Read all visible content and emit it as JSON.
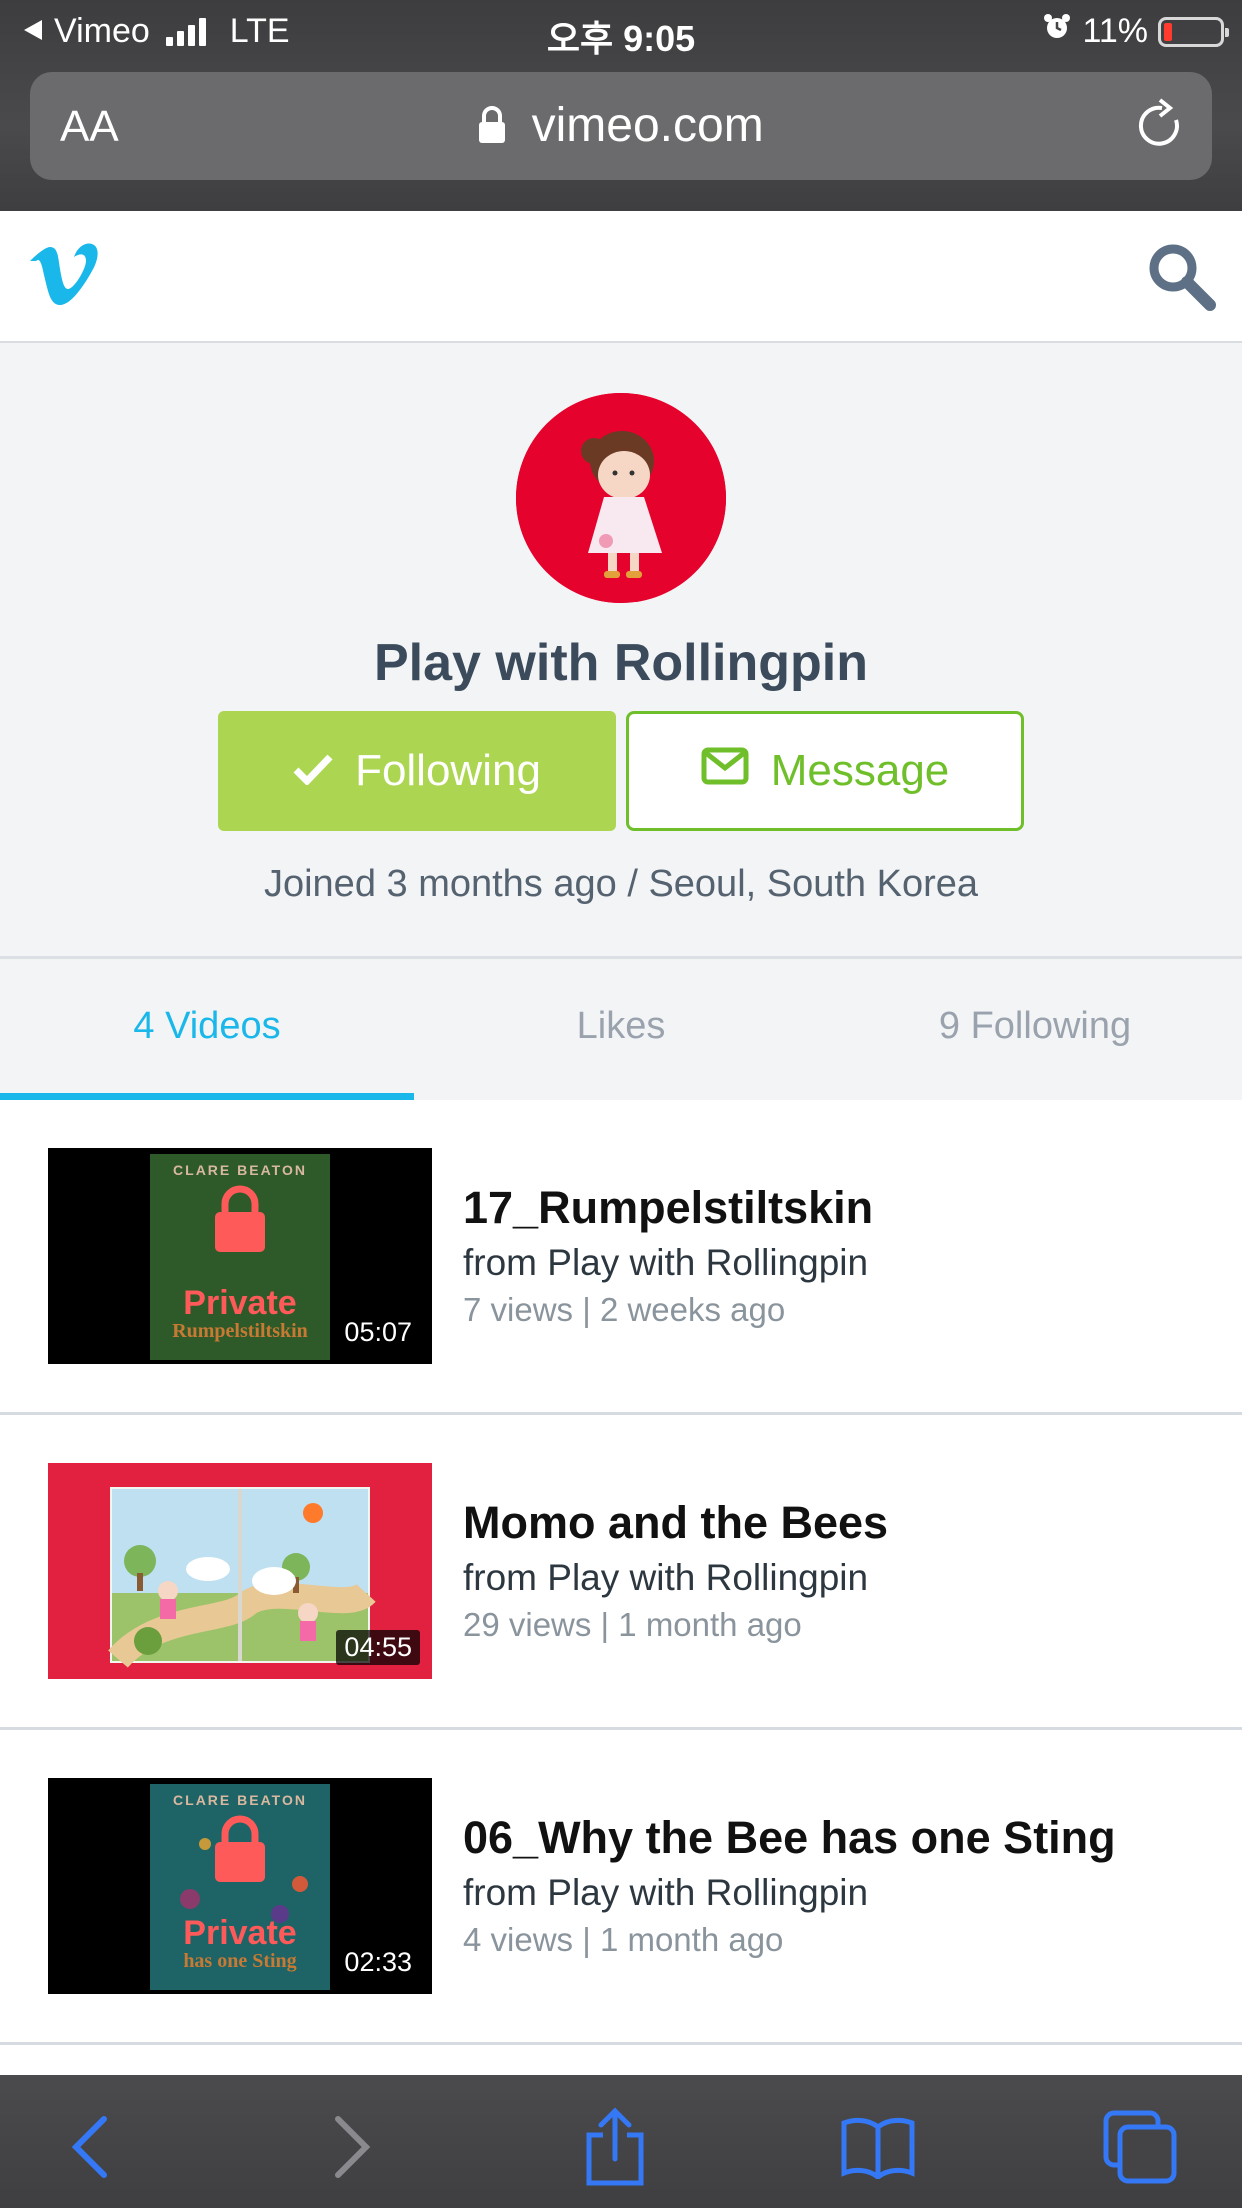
{
  "status_bar": {
    "back_app": "Vimeo",
    "network": "LTE",
    "time": "오후 9:05",
    "battery": "11%"
  },
  "browser": {
    "aa_label": "AA",
    "domain": "vimeo.com"
  },
  "profile": {
    "name": "Play with Rollingpin",
    "follow_label": "Following",
    "message_label": "Message",
    "joined": "Joined 3 months ago / Seoul, South Korea"
  },
  "tabs": [
    {
      "label": "4 Videos",
      "active": true
    },
    {
      "label": "Likes",
      "active": false
    },
    {
      "label": "9 Following",
      "active": false
    }
  ],
  "videos": [
    {
      "title": "17_Rumpelstiltskin",
      "from": "from Play with Rollingpin",
      "meta": "7 views | 2 weeks ago",
      "duration": "05:07",
      "private": "Private",
      "cover_author": "CLARE BEATON",
      "cover_subtitle": "Rumpelstiltskin"
    },
    {
      "title": "Momo and the Bees",
      "from": "from Play with Rollingpin",
      "meta": "29 views | 1 month ago",
      "duration": "04:55"
    },
    {
      "title": "06_Why the Bee has one Sting",
      "from": "from Play with Rollingpin",
      "meta": "4 views | 1 month ago",
      "duration": "02:33",
      "private": "Private",
      "cover_author": "CLARE BEATON",
      "cover_subtitle": "has one Sting"
    }
  ],
  "colors": {
    "vimeo_blue": "#1ab7ea",
    "follow_green": "#acd652",
    "message_green": "#6fbf2a",
    "avatar_red": "#e5032e"
  },
  "icons": {
    "toolbar": [
      "back-icon",
      "forward-icon",
      "share-icon",
      "bookmarks-icon",
      "tabs-icon"
    ]
  }
}
